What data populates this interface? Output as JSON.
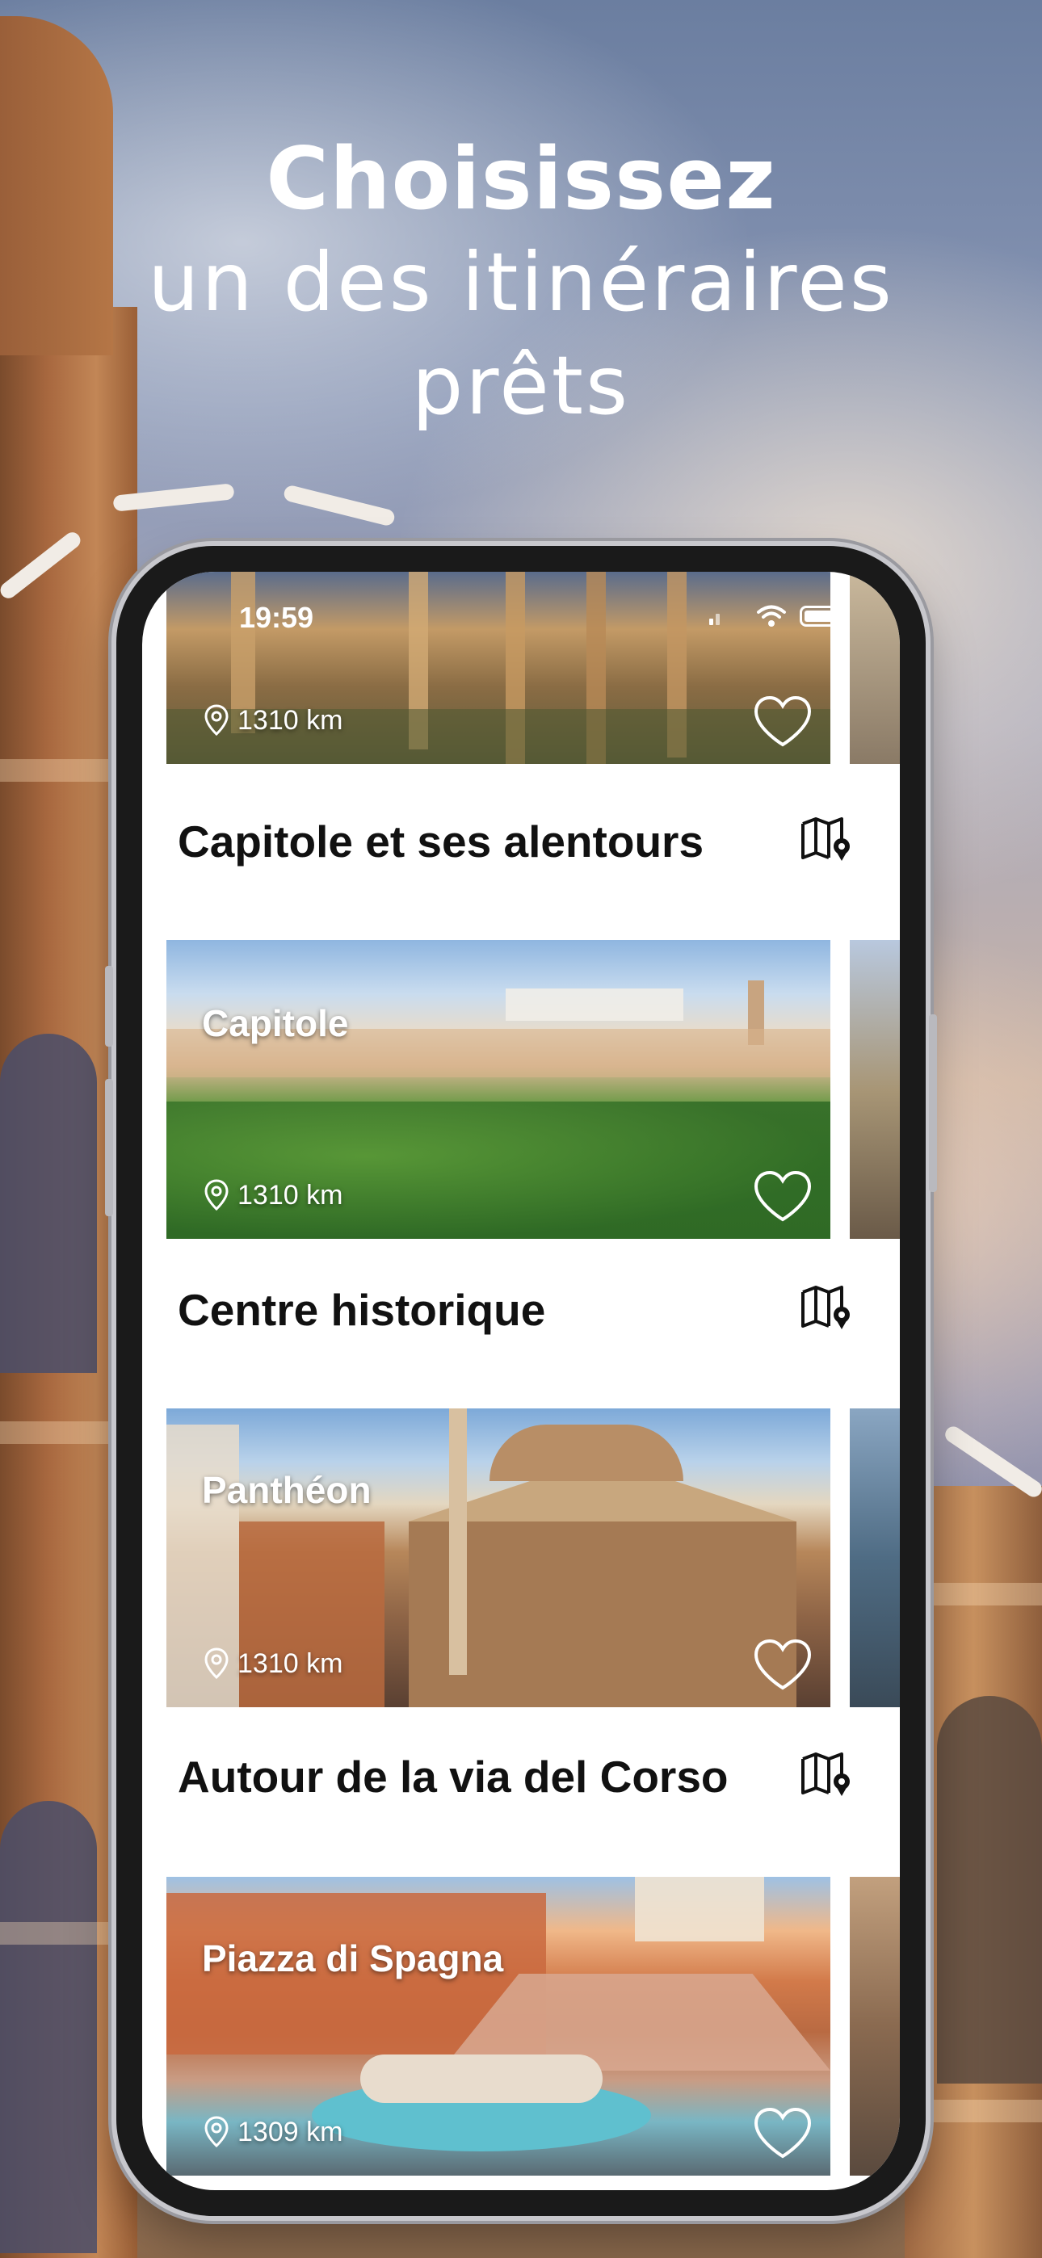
{
  "headline": {
    "line1": "Choisissez",
    "line2": "un des itinéraires",
    "line3": "prêts"
  },
  "status_bar": {
    "time": "19:59"
  },
  "top_card": {
    "distance": "1310 km"
  },
  "sections": [
    {
      "title": "Capitole et ses alentours",
      "card_label": "Capitole",
      "distance": "1310 km"
    },
    {
      "title": "Centre historique",
      "card_label": "Panthéon",
      "distance": "1310 km"
    },
    {
      "title": "Autour de la via del Corso",
      "card_label": "Piazza di Spagna",
      "distance": "1309 km"
    }
  ],
  "icons": {
    "location": "location-pin-icon",
    "favorite": "heart-icon",
    "map": "map-icon"
  }
}
